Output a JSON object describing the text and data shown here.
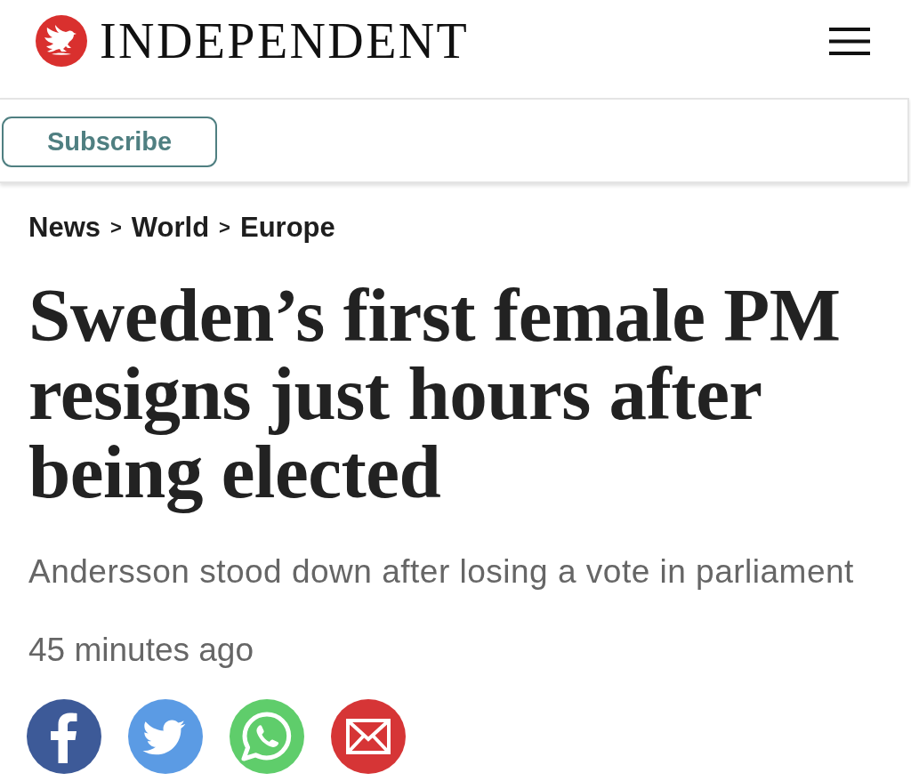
{
  "header": {
    "logo_text": "INDEPENDENT"
  },
  "subscribe_button": {
    "label": "Subscribe"
  },
  "breadcrumb": [
    {
      "kind": "link",
      "text": "News"
    },
    {
      "kind": "separator",
      "text": ">"
    },
    {
      "kind": "link",
      "text": "World"
    },
    {
      "kind": "separator",
      "text": ">"
    },
    {
      "kind": "link",
      "text": "Europe"
    }
  ],
  "article": {
    "headline": "Sweden’s first female PM resigns just hours after being elected",
    "standfirst": "Andersson stood down after losing a vote in parliament",
    "timestamp": "45 minutes ago"
  },
  "share_buttons": [
    {
      "kind": "facebook",
      "color": "#3d5a98"
    },
    {
      "kind": "twitter",
      "color": "#5b9be4"
    },
    {
      "kind": "whatsapp",
      "color": "#5fcd6b"
    },
    {
      "kind": "email",
      "color": "#d63536"
    }
  ]
}
